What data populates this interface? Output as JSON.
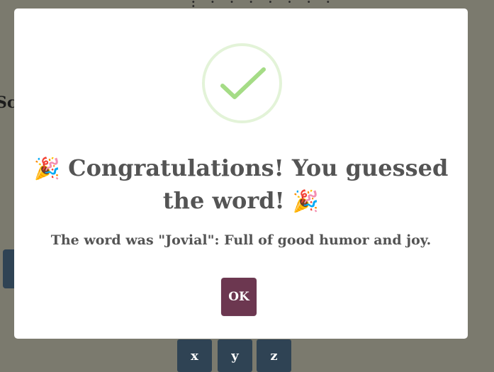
{
  "background": {
    "score_fragment": "Sc",
    "keyboard_keys": [
      "x",
      "y",
      "z"
    ]
  },
  "modal": {
    "icon": "checkmark-icon",
    "title_icon": "party-popper-icon",
    "title_party_emoji": "🎉",
    "title_text": "Congratulations! You guessed the word!",
    "message": "The word was \"Jovial\": Full of good humor and joy.",
    "ok_label": "OK"
  },
  "colors": {
    "overlay": "#7b7a6e",
    "modal_bg": "#ffffff",
    "check": "#a5dc86",
    "check_ring": "#e3f3d8",
    "text": "#545454",
    "ok_button": "#6c3750",
    "key_bg": "#2f4354"
  }
}
